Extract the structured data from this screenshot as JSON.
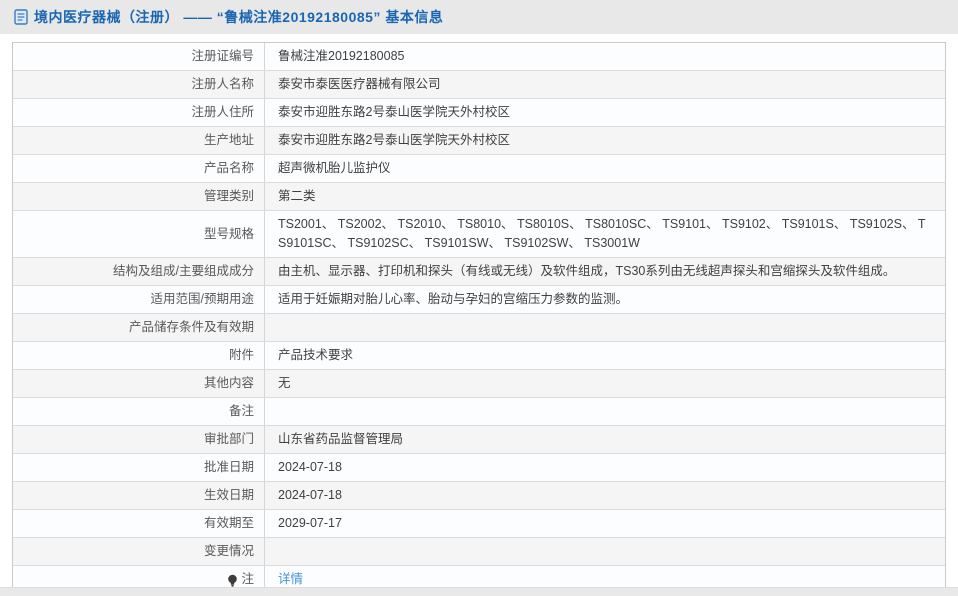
{
  "header": {
    "icon": "document-icon",
    "title": "境内医疗器械（注册） —— “鲁械注准20192180085” 基本信息"
  },
  "colors": {
    "header_band_bg": "#e8e8e9",
    "title_blue": "#1a66b2",
    "link_blue": "#4193d5",
    "row_even_bg": "#f5f5f6",
    "row_odd_bg": "#fcfdfe",
    "border": "#c9c9c9"
  },
  "table": {
    "rows": [
      {
        "label": "注册证编号",
        "value": "鲁械注准20192180085"
      },
      {
        "label": "注册人名称",
        "value": "泰安市泰医医疗器械有限公司"
      },
      {
        "label": "注册人住所",
        "value": "泰安市迎胜东路2号泰山医学院天外村校区"
      },
      {
        "label": "生产地址",
        "value": "泰安市迎胜东路2号泰山医学院天外村校区"
      },
      {
        "label": "产品名称",
        "value": "超声微机胎儿监护仪"
      },
      {
        "label": "管理类别",
        "value": "第二类"
      },
      {
        "label": "型号规格",
        "value": "TS2001、 TS2002、 TS2010、 TS8010、 TS8010S、 TS8010SC、 TS9101、 TS9102、 TS9101S、 TS9102S、 TS9101SC、 TS9102SC、 TS9101SW、 TS9102SW、 TS3001W"
      },
      {
        "label": "结构及组成/主要组成成分",
        "value": "由主机、显示器、打印机和探头（有线或无线）及软件组成，TS30系列由无线超声探头和宫缩探头及软件组成。"
      },
      {
        "label": "适用范围/预期用途",
        "value": "适用于妊娠期对胎儿心率、胎动与孕妇的宫缩压力参数的监测。"
      },
      {
        "label": "产品储存条件及有效期",
        "value": ""
      },
      {
        "label": "附件",
        "value": "产品技术要求"
      },
      {
        "label": "其他内容",
        "value": "无"
      },
      {
        "label": "备注",
        "value": ""
      },
      {
        "label": "审批部门",
        "value": "山东省药品监督管理局"
      },
      {
        "label": "批准日期",
        "value": "2024-07-18"
      },
      {
        "label": "生效日期",
        "value": "2024-07-18"
      },
      {
        "label": "有效期至",
        "value": "2029-07-17"
      },
      {
        "label": "变更情况",
        "value": ""
      },
      {
        "label": "注",
        "value": "详情",
        "value_is_link": true,
        "label_icon": "bulb-icon"
      }
    ]
  }
}
